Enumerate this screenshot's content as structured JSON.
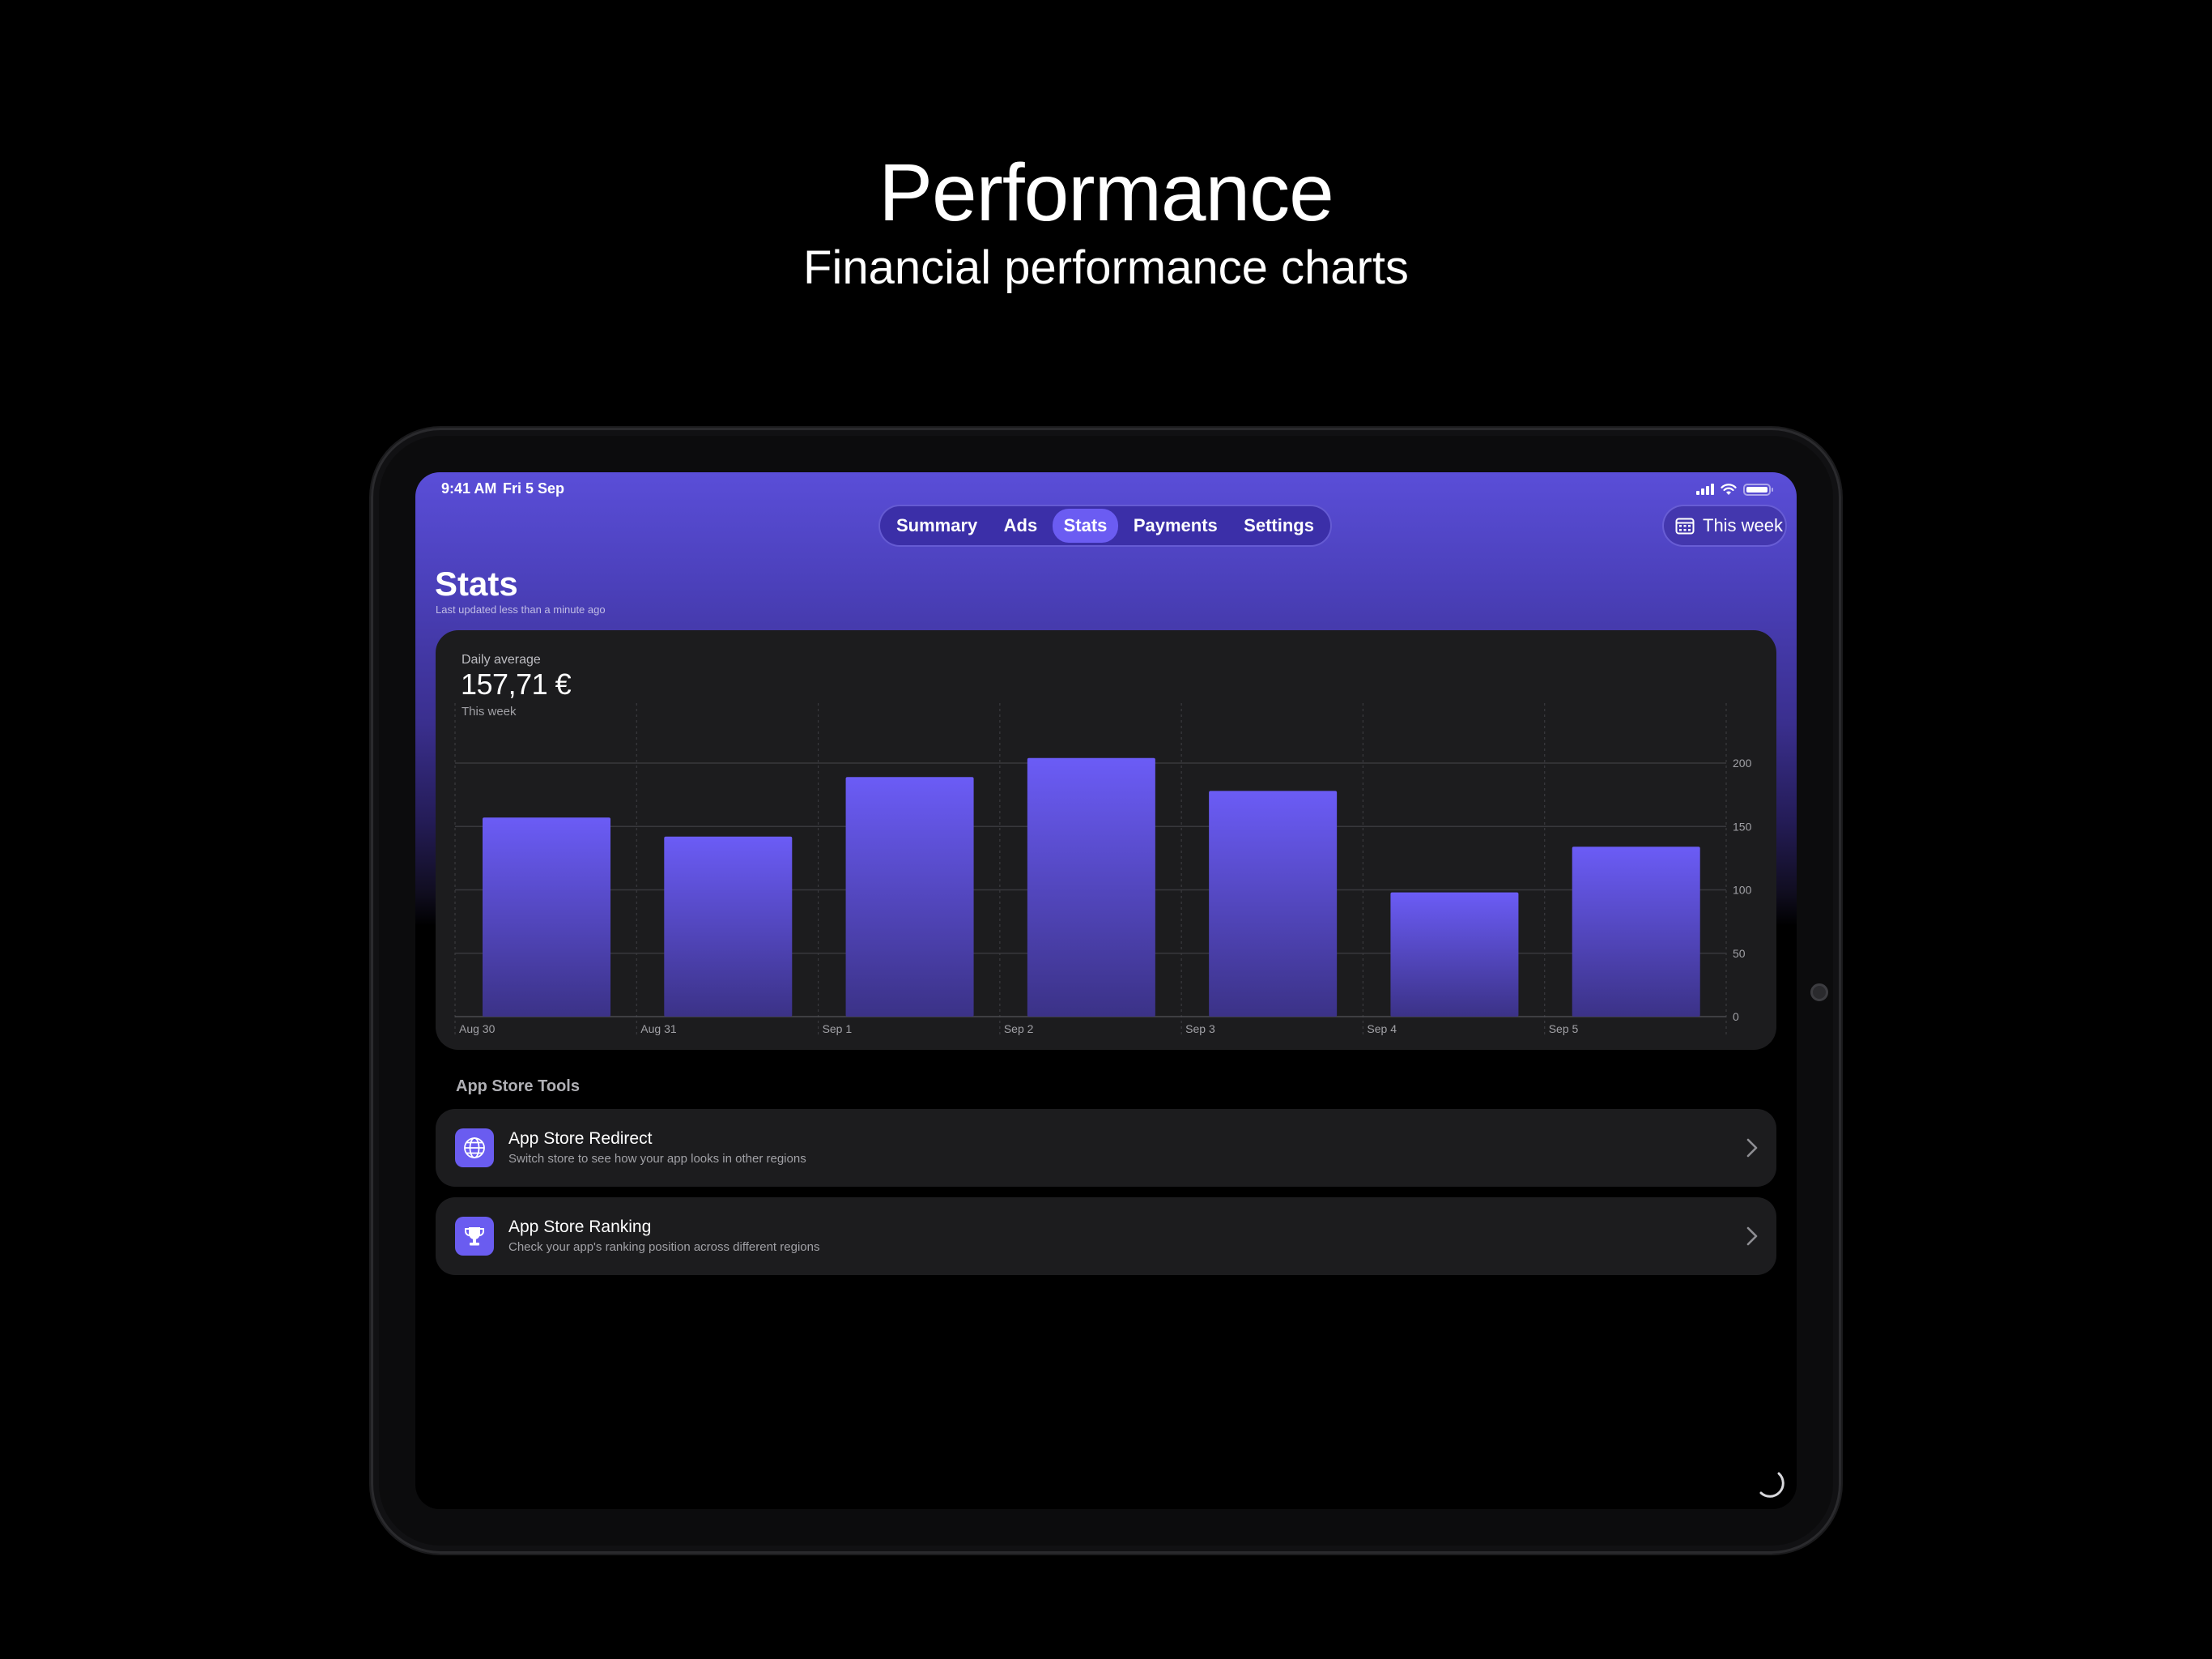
{
  "marketing": {
    "headline": "Performance",
    "subheadline": "Financial performance charts"
  },
  "status_bar": {
    "time": "9:41 AM",
    "date": "Fri 5 Sep"
  },
  "tabs": [
    {
      "label": "Summary",
      "active": false
    },
    {
      "label": "Ads",
      "active": false
    },
    {
      "label": "Stats",
      "active": true
    },
    {
      "label": "Payments",
      "active": false
    },
    {
      "label": "Settings",
      "active": false
    }
  ],
  "period_button": {
    "label": "This week",
    "icon": "calendar-icon"
  },
  "page": {
    "title": "Stats",
    "subtitle": "Last updated less than a minute ago"
  },
  "stat": {
    "label": "Daily average",
    "value": "157,71 €",
    "period": "This week"
  },
  "chart_data": {
    "type": "bar",
    "categories": [
      "Aug 30",
      "Aug 31",
      "Sep 1",
      "Sep 2",
      "Sep 3",
      "Sep 4",
      "Sep 5"
    ],
    "values": [
      157,
      142,
      189,
      204,
      178,
      98,
      134
    ],
    "ylim": [
      0,
      220
    ],
    "yticks": [
      0,
      50,
      100,
      150,
      200
    ],
    "grid": true,
    "bar_color_top": "#6b5cf6",
    "bar_color_bottom": "#3b3287"
  },
  "tools_section": {
    "title": "App Store Tools",
    "items": [
      {
        "title": "App Store Redirect",
        "subtitle": "Switch store to see how your app looks in other regions",
        "icon": "globe-icon"
      },
      {
        "title": "App Store Ranking",
        "subtitle": "Check your app's ranking position across different regions",
        "icon": "trophy-icon"
      }
    ]
  },
  "colors": {
    "accent": "#6a5cf0",
    "card": "#1c1c1e"
  }
}
